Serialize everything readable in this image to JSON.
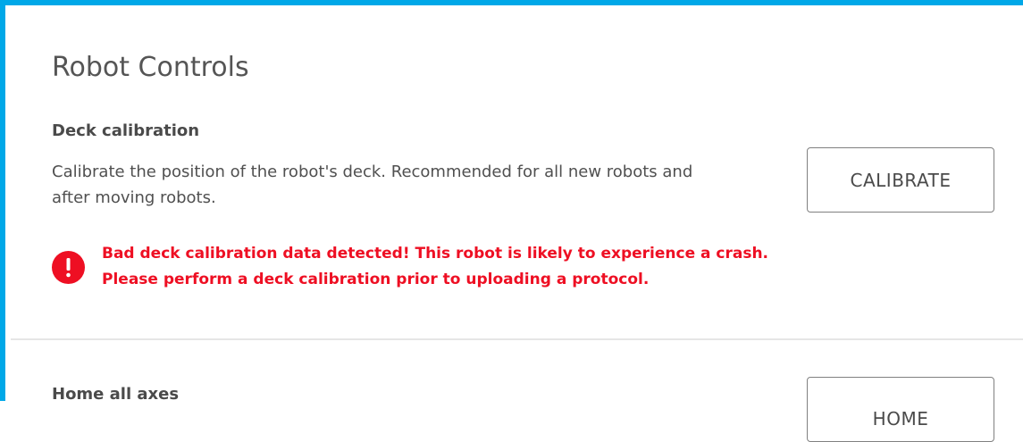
{
  "panel": {
    "title": "Robot Controls"
  },
  "deck_calibration": {
    "title": "Deck calibration",
    "description": "Calibrate the position of the robot's deck. Recommended for all new robots and after moving robots.",
    "button_label": "CALIBRATE",
    "warning_icon": "exclamation-circle-icon",
    "warning_color": "#ee0f23",
    "warning_line_1": "Bad deck calibration data detected! This robot is likely to experience a crash.",
    "warning_line_2": "Please perform a deck calibration prior to uploading a protocol."
  },
  "home_all_axes": {
    "title": "Home all axes",
    "button_label": "HOME"
  },
  "colors": {
    "accent_border": "#00a8e8",
    "divider": "#e6e6e6"
  }
}
